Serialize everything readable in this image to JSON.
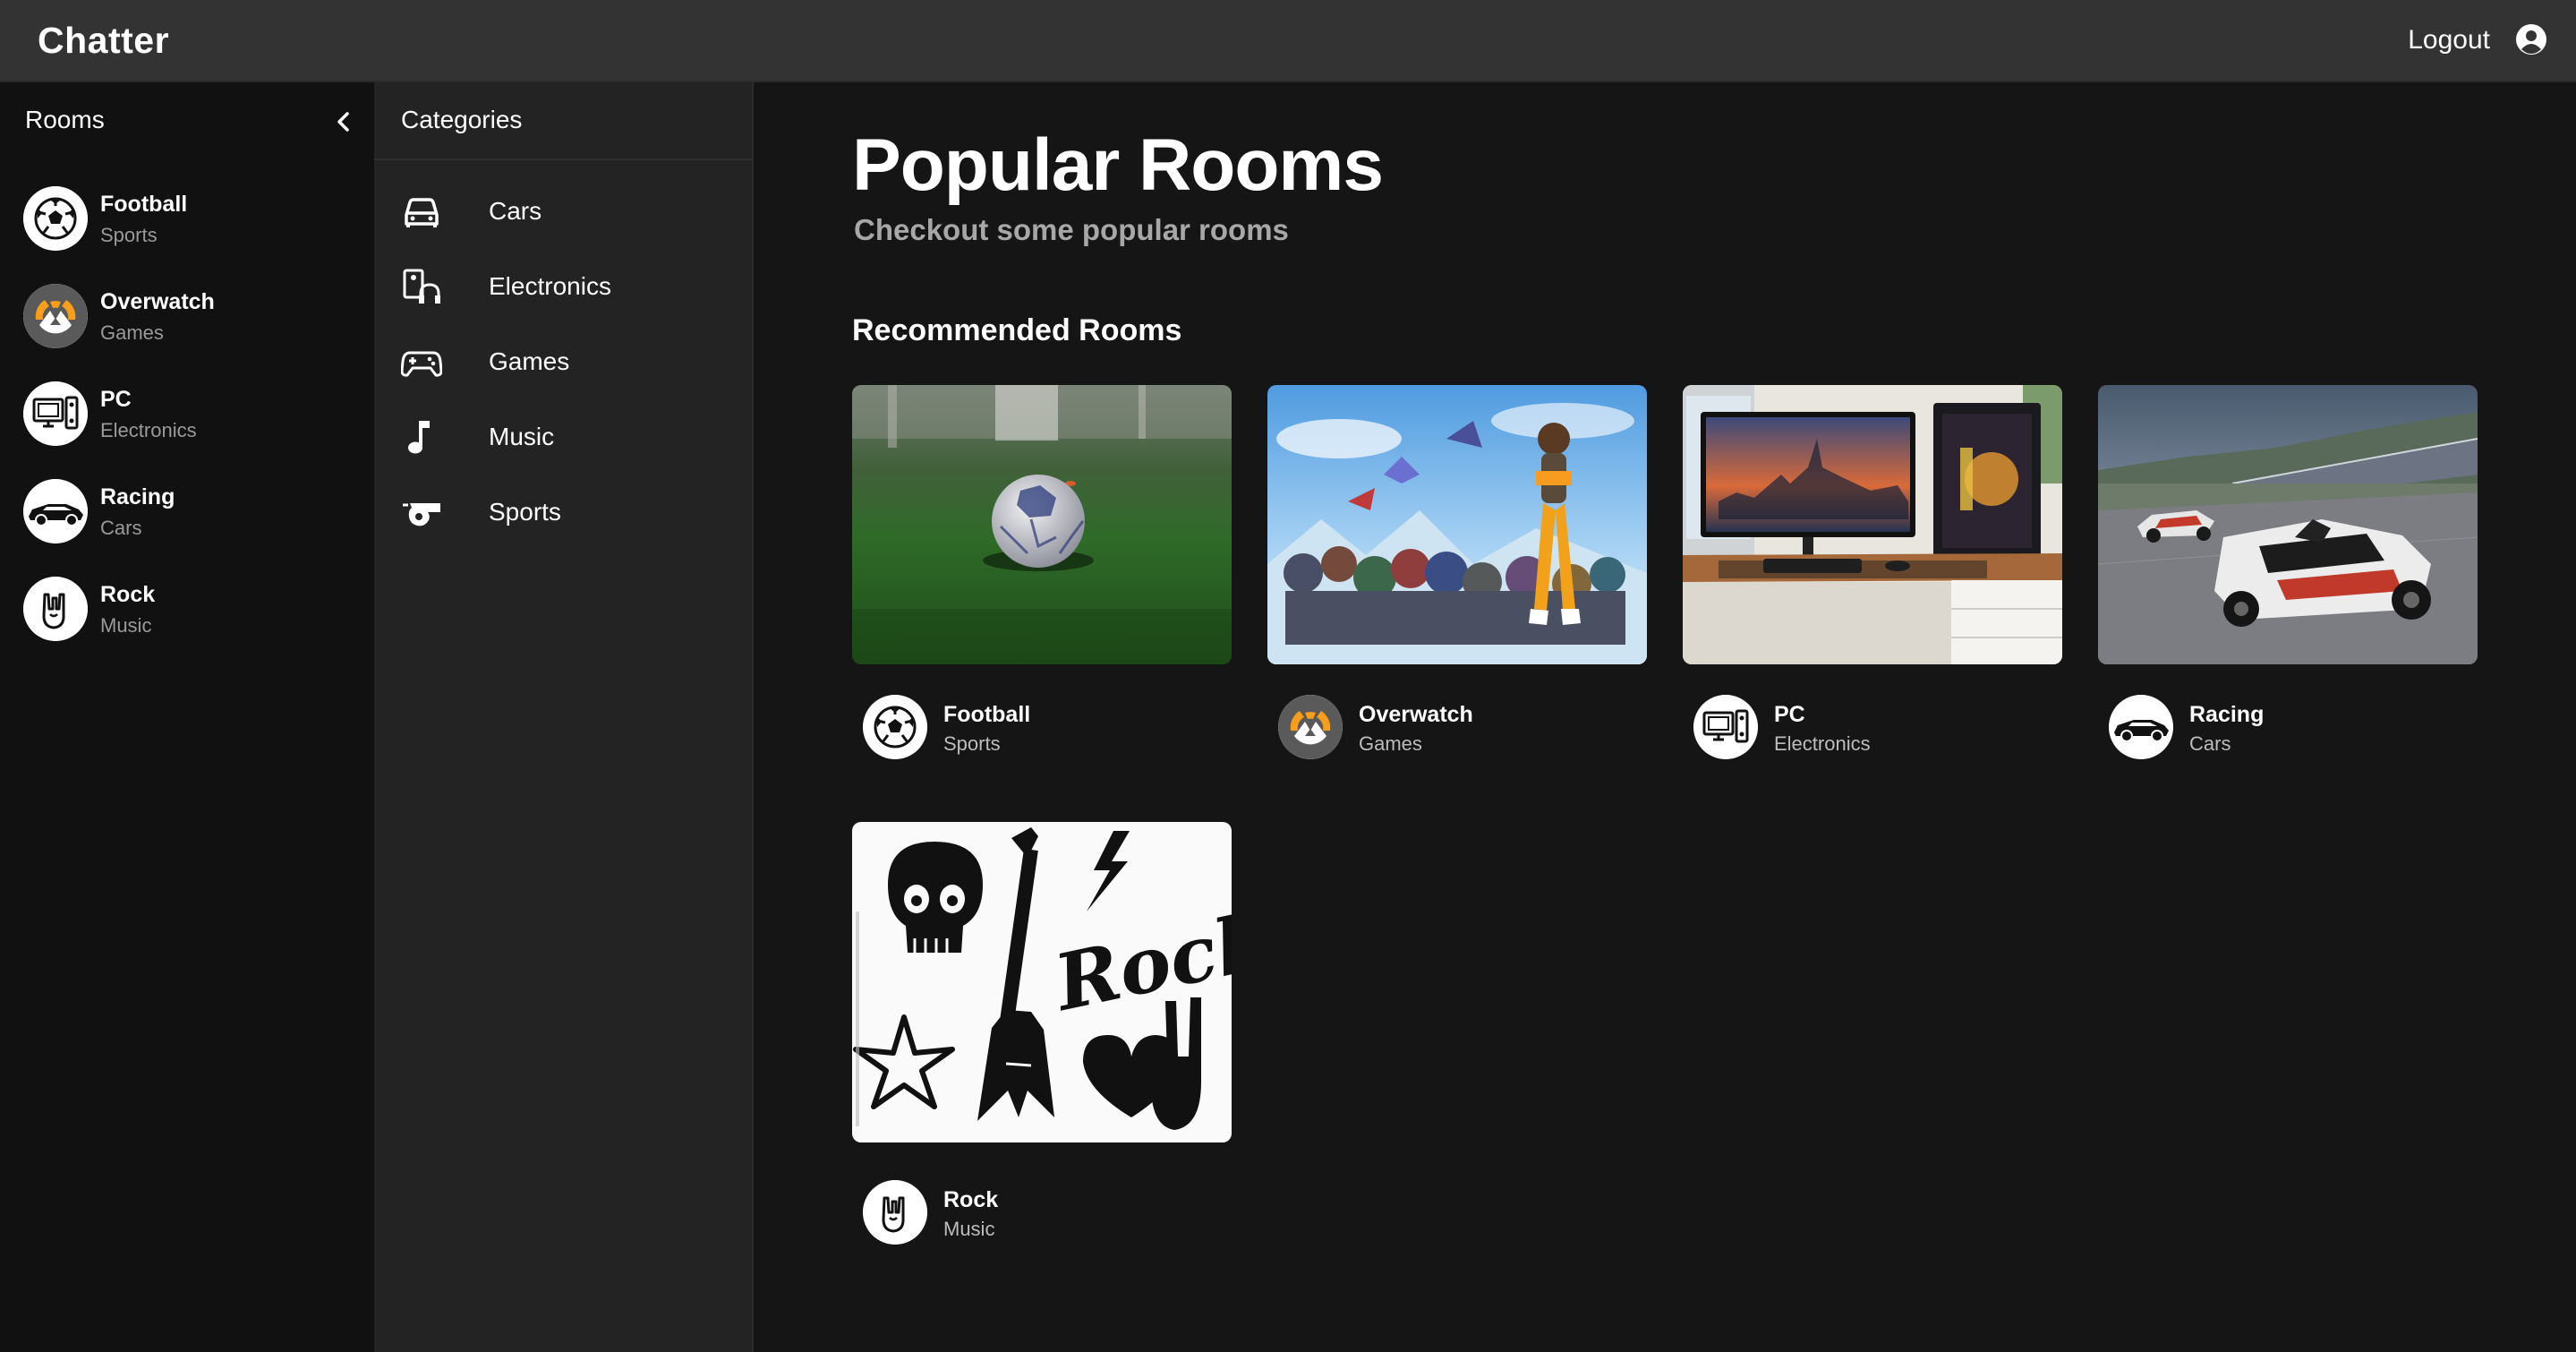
{
  "app": {
    "brand": "Chatter",
    "logout": "Logout"
  },
  "sidebar": {
    "title": "Rooms",
    "items": [
      {
        "name": "Football",
        "category": "Sports"
      },
      {
        "name": "Overwatch",
        "category": "Games"
      },
      {
        "name": "PC",
        "category": "Electronics"
      },
      {
        "name": "Racing",
        "category": "Cars"
      },
      {
        "name": "Rock",
        "category": "Music"
      }
    ]
  },
  "categories": {
    "title": "Categories",
    "items": [
      {
        "label": "Cars",
        "icon": "car-icon"
      },
      {
        "label": "Electronics",
        "icon": "electronics-icon"
      },
      {
        "label": "Games",
        "icon": "gamepad-icon"
      },
      {
        "label": "Music",
        "icon": "music-note-icon"
      },
      {
        "label": "Sports",
        "icon": "whistle-icon"
      }
    ]
  },
  "main": {
    "title": "Popular Rooms",
    "subtitle": "Checkout some popular rooms",
    "section": "Recommended Rooms",
    "cards": [
      {
        "name": "Football",
        "category": "Sports"
      },
      {
        "name": "Overwatch",
        "category": "Games"
      },
      {
        "name": "PC",
        "category": "Electronics"
      },
      {
        "name": "Racing",
        "category": "Cars"
      },
      {
        "name": "Rock",
        "category": "Music"
      }
    ],
    "rock_art_text": "Rock!"
  },
  "colors": {
    "background": "#151515",
    "topbar": "#333333",
    "sidebar": "#111111",
    "categories": "#232323",
    "subtitle": "#a7a7a7"
  }
}
